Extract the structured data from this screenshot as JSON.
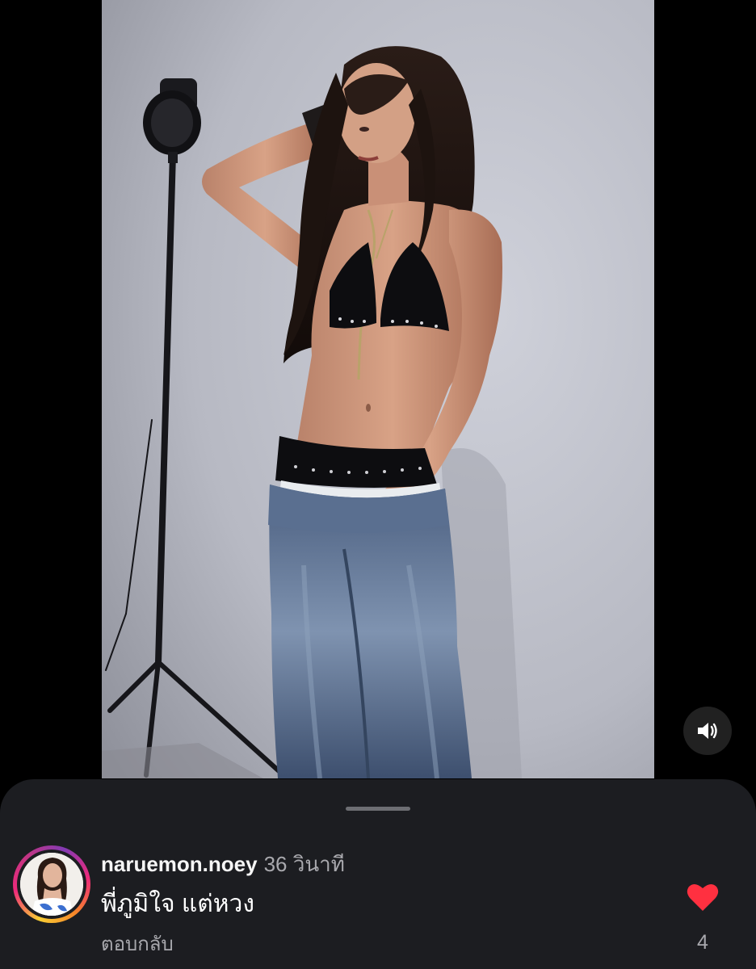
{
  "story": {
    "media": {
      "image_name": "studio-portrait-photo",
      "sound_icon": "speaker-volume-icon"
    }
  },
  "comment_sheet": {
    "comment": {
      "username": "naruemon.noey",
      "timestamp": "36 วินาที",
      "text": "พี่ภูมิใจ แต่หวง",
      "reply_label": "ตอบกลับ",
      "like_count": "4",
      "like_icon": "heart-icon",
      "liked": true
    }
  },
  "colors": {
    "like_red": "#ff3040",
    "sheet_background": "#1c1d21",
    "secondary_text": "#a8a8ad"
  }
}
